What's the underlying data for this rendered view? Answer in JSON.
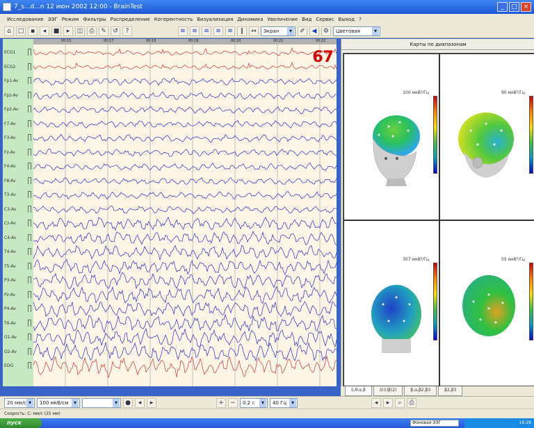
{
  "window": {
    "title": "7_s...d...n 12 июн 2002 12:00 - BrainTest"
  },
  "menu": [
    "Исследование",
    "ЭЭГ",
    "Режим",
    "Фильтры",
    "Распределение",
    "Когерентность",
    "Визуализация",
    "Динамика",
    "Увеличение",
    "Вид",
    "Сервис",
    "Выход",
    "?"
  ],
  "toolbar": {
    "combo1": "Экран",
    "combo2": "Цветовая"
  },
  "eeg": {
    "channels": [
      "ECG1",
      "ECG2",
      "Fp1-Av",
      "Fpz-Av",
      "Fp2-Av",
      "F7-Av",
      "F3-Av",
      "Fz-Av",
      "F4-Av",
      "F8-Av",
      "T3-Av",
      "C3-Av",
      "Cz-Av",
      "C4-Av",
      "T4-Av",
      "T5-Av",
      "P3-Av",
      "Pz-Av",
      "P4-Av",
      "T6-Av",
      "O1-Av",
      "O2-Av",
      "EOG"
    ],
    "time_marks": [
      "00:15",
      "00:17",
      "00:18",
      "00:19",
      "00:20",
      "00:21",
      "00:22"
    ],
    "overlay_number": "67"
  },
  "maps": {
    "header": "Карты по диапазонам",
    "cells": [
      {
        "freq": "100 мкВ²/Гц",
        "view": "front-left",
        "colors": [
          "#2fa8e6",
          "#28c060",
          "#6ad040"
        ]
      },
      {
        "freq": "90 мкВ²/Гц",
        "view": "back",
        "colors": [
          "#2ab0d0",
          "#50c840",
          "#d0e020"
        ]
      },
      {
        "freq": "307 мкВ²/Гц",
        "view": "back-blue",
        "colors": [
          "#2040c8",
          "#20a0c0",
          "#50c850"
        ]
      },
      {
        "freq": "55 мкВ²/Гц",
        "view": "top",
        "colors": [
          "#28b080",
          "#30c040",
          "#e0a020"
        ]
      }
    ]
  },
  "tabs": [
    "δ,θ,α,β",
    "δ(1)β(2)",
    "β,α,β2,β3",
    "β2,β3"
  ],
  "bottombar": {
    "combo1": "20 мм/с",
    "combo2": "100 мкВ/см",
    "combo3": "",
    "combo4": "0.2 с",
    "combo5": "40 Гц"
  },
  "status": "Скорость: C: мм/с (25 мм)",
  "taskbar": {
    "start": "пуск",
    "app": "Фоновая ЭЭГ",
    "clock": "16:29"
  }
}
